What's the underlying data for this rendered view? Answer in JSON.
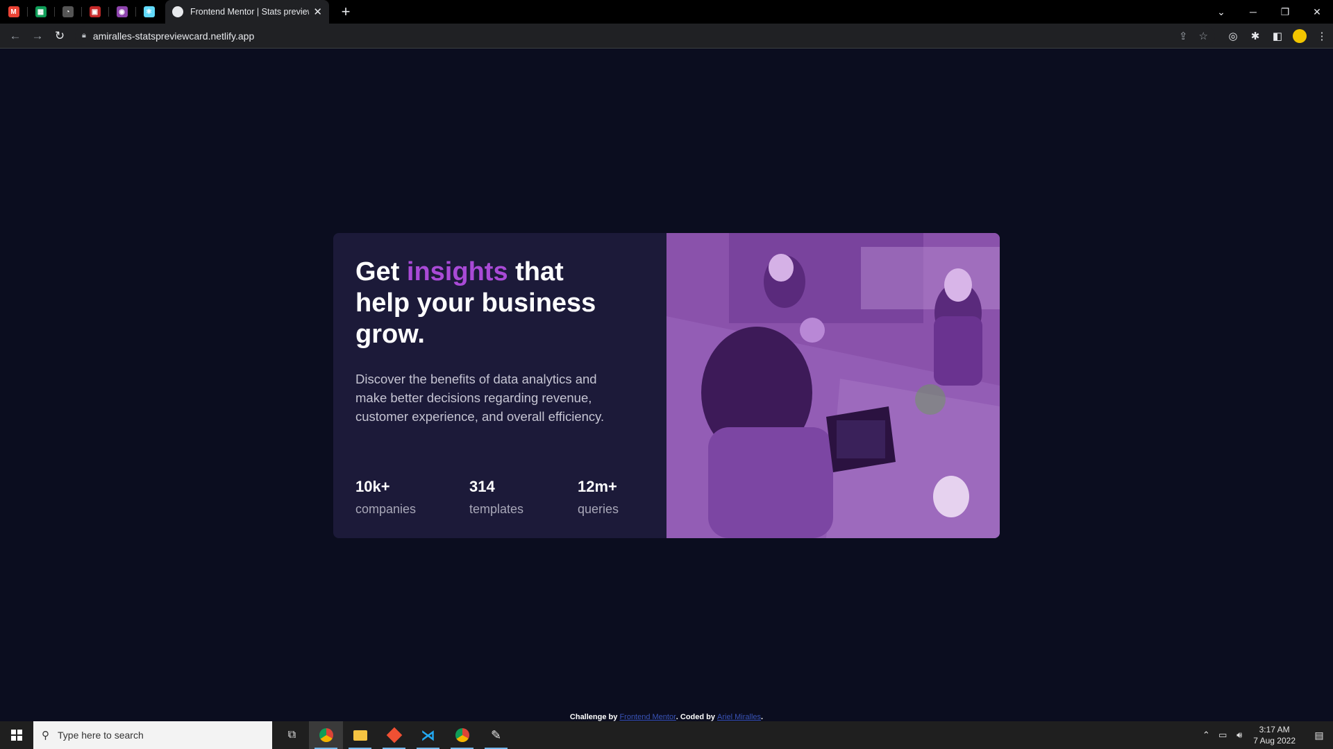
{
  "browser": {
    "pinned_tabs": [
      {
        "icon": "gmail-icon",
        "glyph": "M",
        "color": "#ea4335"
      },
      {
        "icon": "sheets-icon",
        "glyph": "▦",
        "color": "#0f9d58"
      },
      {
        "icon": "github-icon",
        "glyph": "◔",
        "color": "#555555"
      },
      {
        "icon": "app-icon",
        "glyph": "▣",
        "color": "#c62828"
      },
      {
        "icon": "purple-app-icon",
        "glyph": "◉",
        "color": "#8e44ad"
      },
      {
        "icon": "react-icon",
        "glyph": "⚛",
        "color": "#61dafb"
      }
    ],
    "active_tab_title": "Frontend Mentor | Stats preview",
    "url": "amiralles-statspreviewcard.netlify.app"
  },
  "card": {
    "headline_pre": "Get ",
    "headline_accent": "insights",
    "headline_post": " that help your business grow.",
    "description": "Discover the benefits of data analytics and make better decisions regarding revenue, customer experience, and overall efficiency.",
    "stats": [
      {
        "value": "10k+",
        "label": "companies"
      },
      {
        "value": "314",
        "label": "templates"
      },
      {
        "value": "12m+",
        "label": "queries"
      }
    ],
    "accent_color": "#a94ad6",
    "image_tint": "#8d56ad"
  },
  "footer": {
    "prefix": "Challenge by ",
    "link1": "Frontend Mentor",
    "middle": ". Coded by ",
    "link2": "Ariel Miralles",
    "suffix": "."
  },
  "taskbar": {
    "search_placeholder": "Type here to search",
    "time": "3:17 AM",
    "date": "7 Aug 2022"
  }
}
